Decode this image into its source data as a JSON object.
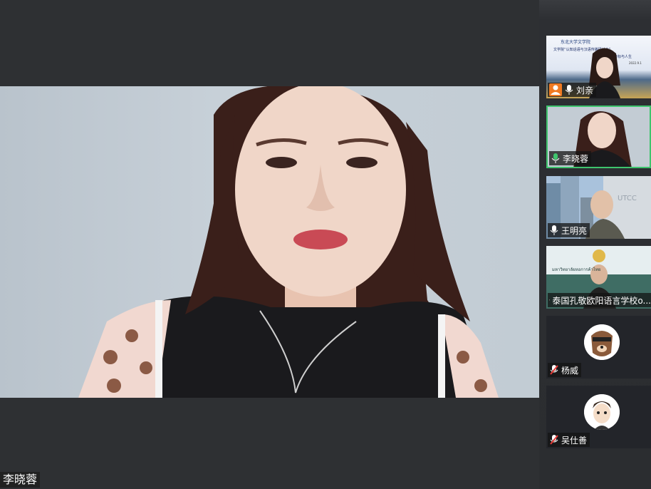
{
  "meeting": {
    "active_speaker": "李晓蓉"
  },
  "participants": [
    {
      "name": "刘亲",
      "mic": "on",
      "host": true
    },
    {
      "name": "李晓蓉",
      "mic": "speaking",
      "active": true
    },
    {
      "name": "王明亮",
      "mic": "on"
    },
    {
      "name": "泰国孔敬欧阳语言学校o...",
      "mic": "muted"
    },
    {
      "name": "杨威",
      "mic": "muted"
    },
    {
      "name": "吴仕善",
      "mic": "muted"
    }
  ],
  "tiles": {
    "slide_logo_text": "东北大学文学院",
    "slide_title": "文学院“认知话语与汉语传播研讨会”",
    "slide_subtitle": "暨你的目标与人生",
    "slide_date": "2022.9.1",
    "utcc_sign": "UTCC",
    "thai_banner": "มหาวิทยาลัยหอการค้าไทย"
  },
  "colors": {
    "active_border": "#3ec46d",
    "host_badge": "#f07a22",
    "muted_red": "#e53935"
  }
}
